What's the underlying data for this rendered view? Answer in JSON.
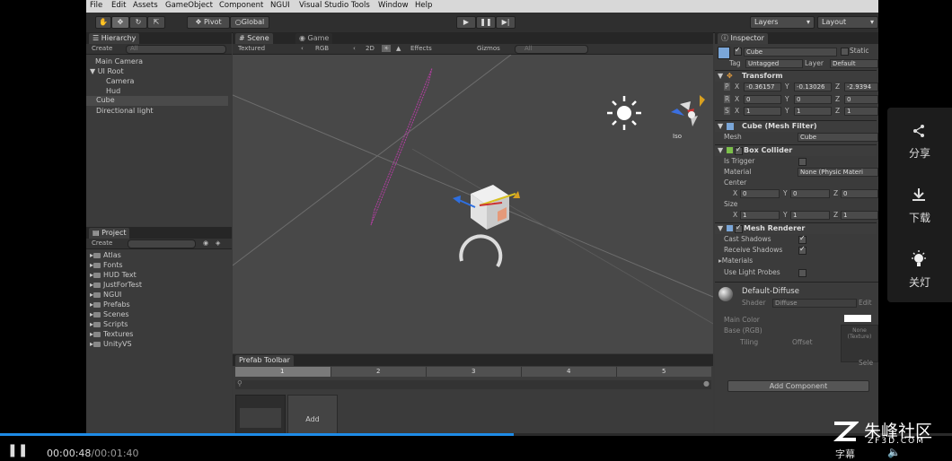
{
  "menubar": {
    "items": [
      "File",
      "Edit",
      "Assets",
      "GameObject",
      "Component",
      "NGUI",
      "Visual Studio Tools",
      "Window",
      "Help"
    ]
  },
  "toolbar": {
    "pivot": "Pivot",
    "global": "Global",
    "layers": "Layers",
    "layout": "Layout"
  },
  "hierarchy": {
    "tab": "Hierarchy",
    "create": "Create",
    "search": "All",
    "items": [
      "Main Camera",
      "UI Root",
      "Camera",
      "Hud",
      "Cube",
      "Directional light"
    ]
  },
  "project": {
    "tab": "Project",
    "create": "Create",
    "folders": [
      "Atlas",
      "Fonts",
      "HUD Text",
      "JustForTest",
      "NGUI",
      "Prefabs",
      "Scenes",
      "Scripts",
      "Textures",
      "UnityVS"
    ]
  },
  "scene": {
    "tab_scene": "Scene",
    "tab_game": "Game",
    "textured": "Textured",
    "rgb": "RGB",
    "mode2d": "2D",
    "effects": "Effects",
    "gizmos": "Gizmos",
    "search": "All",
    "persp": "Iso"
  },
  "prefab_toolbar": {
    "tab": "Prefab Toolbar",
    "pages": [
      "1",
      "2",
      "3",
      "4",
      "5"
    ],
    "add": "Add"
  },
  "inspector": {
    "tab": "Inspector",
    "object_name": "Cube",
    "static": "Static",
    "tag_label": "Tag",
    "tag_value": "Untagged",
    "layer_label": "Layer",
    "layer_value": "Default",
    "transform": {
      "title": "Transform",
      "position": [
        "-0.36157",
        "-0.13026",
        "-2.9394"
      ],
      "rotation": [
        "0",
        "0",
        "0"
      ],
      "scale": [
        "1",
        "1",
        "1"
      ]
    },
    "mesh_filter": {
      "title": "Cube (Mesh Filter)",
      "mesh_label": "Mesh",
      "mesh_value": "Cube"
    },
    "box_collider": {
      "title": "Box Collider",
      "is_trigger": "Is Trigger",
      "material": "Material",
      "material_value": "None (Physic Materi",
      "center": "Center",
      "center_vals": [
        "0",
        "0",
        "0"
      ],
      "size": "Size",
      "size_vals": [
        "1",
        "1",
        "1"
      ]
    },
    "mesh_renderer": {
      "title": "Mesh Renderer",
      "cast_shadows": "Cast Shadows",
      "receive_shadows": "Receive Shadows",
      "materials": "Materials",
      "use_light_probes": "Use Light Probes"
    },
    "material": {
      "name": "Default-Diffuse",
      "shader_label": "Shader",
      "shader_value": "Diffuse",
      "edit": "Edit",
      "main_color": "Main Color",
      "base_rgb": "Base (RGB)",
      "tiling": "Tiling",
      "offset": "Offset",
      "none_tex": "None (Texture)",
      "select": "Sele"
    },
    "add_component": "Add Component"
  },
  "side_panel": {
    "share": "分享",
    "download": "下载",
    "lights_off": "关灯"
  },
  "player": {
    "current_time": "00:00:48",
    "total_time": "/00:01:40",
    "progress": 0.54,
    "subtitle": "字幕"
  },
  "watermark": {
    "brand": "朱峰社区",
    "url": "ZF3D.COM"
  },
  "colors": {
    "progress": "#1e8be6",
    "selection": "#4a4a4a",
    "material_frame": "#b13ea0"
  }
}
